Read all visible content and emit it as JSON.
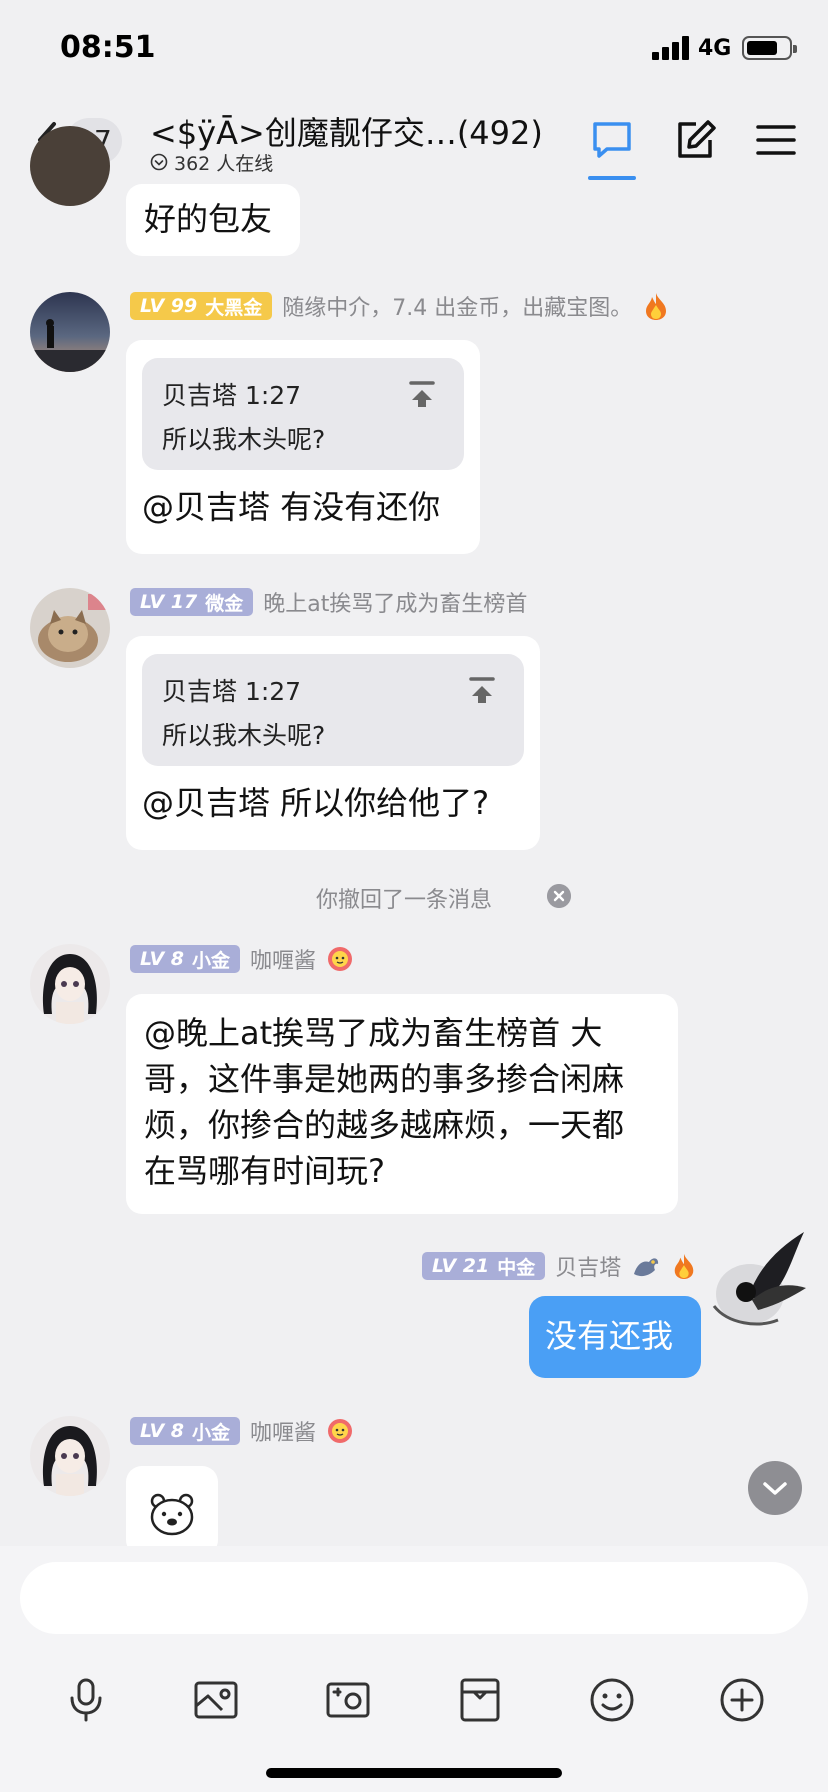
{
  "status_bar": {
    "time": "08:51",
    "network": "4G"
  },
  "header": {
    "back_count": "97",
    "title": "<$ÿĀ>创魔靓仔交…(492)",
    "online": "362 人在线"
  },
  "messages": [
    {
      "text": "好的包友"
    },
    {
      "level": "LV 99",
      "title": "大黑金",
      "name": "随缘中介，7.4 出金币，出藏宝图。",
      "quote_author": "贝吉塔 1:27",
      "quote_text": "所以我木头呢?",
      "text": "@贝吉塔 有没有还你"
    },
    {
      "level": "LV 17",
      "title": "微金",
      "name": "晚上at挨骂了成为畜生榜首",
      "quote_author": "贝吉塔 1:27",
      "quote_text": "所以我木头呢?",
      "text": "@贝吉塔 所以你给他了?"
    },
    {
      "level": "LV 8",
      "title": "小金",
      "name": "咖喱酱",
      "text_lines": [
        "@晚上at挨骂了成为畜生榜首 大",
        "哥，这件事是她两的事多掺合闲麻",
        "烦，你掺合的越多越麻烦，一天都",
        "在骂哪有时间玩?"
      ]
    },
    {
      "level": "LV 21",
      "title": "中金",
      "name": "贝吉塔",
      "text": "没有还我"
    },
    {
      "level": "LV 8",
      "title": "小金",
      "name": "咖喱酱"
    }
  ],
  "recall_notice": "你撤回了一条消息",
  "colors": {
    "accent": "#3a8ff0",
    "own_bubble": "#4a9ff5",
    "badge_gold": "#f5c94a",
    "badge_lavender": "#a9aed8"
  },
  "icons": [
    "back-chevron-icon",
    "chat-bubble-icon",
    "edit-icon",
    "menu-icon",
    "microphone-icon",
    "image-icon",
    "camera-icon",
    "package-icon",
    "emoji-icon",
    "plus-icon"
  ]
}
